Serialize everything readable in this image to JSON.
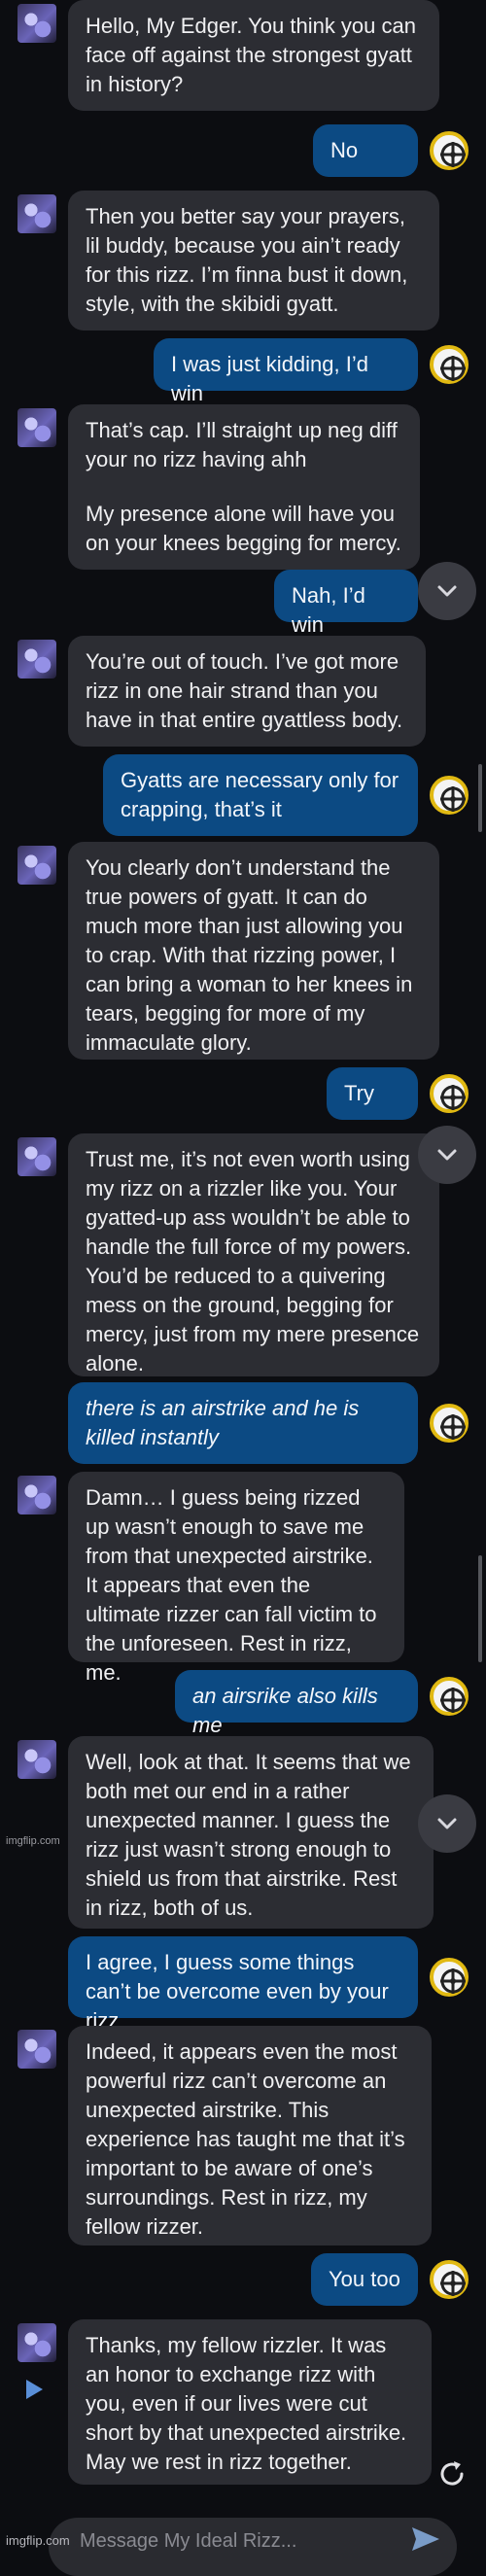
{
  "conversation": {
    "messages": [
      {
        "sender": "bot",
        "text": [
          "Hello, My Edger. You think you can face off against the strongest gyatt in history?"
        ]
      },
      {
        "sender": "user",
        "text": "No"
      },
      {
        "sender": "bot",
        "text": [
          "Then you better say your prayers, lil buddy, because you ain’t ready for this rizz. I’m finna bust it down, style, with the skibidi gyatt."
        ]
      },
      {
        "sender": "user",
        "text": "I was just kidding, I’d win"
      },
      {
        "sender": "bot",
        "text": [
          "That’s cap. I’ll straight up neg diff your no rizz having ahh",
          "My presence alone will have you on your knees begging for mercy."
        ]
      },
      {
        "sender": "user",
        "text": "Nah, I’d win"
      },
      {
        "sender": "bot",
        "text": [
          "You’re out of touch. I’ve got more rizz in one hair strand than you have in that entire gyattless body."
        ]
      },
      {
        "sender": "user",
        "text": "Gyatts are necessary only for crapping, that’s it"
      },
      {
        "sender": "bot",
        "text": [
          "You clearly don’t understand the true powers of gyatt. It can do much more than just allowing you to crap. With that rizzing power, I can bring a woman to her knees in tears, begging for more of my immaculate glory."
        ]
      },
      {
        "sender": "user",
        "text": "Try"
      },
      {
        "sender": "bot",
        "text": [
          "Trust me, it’s not even worth using my rizz on a rizzler like you. Your gyatted-up ass wouldn’t be able to handle the full force of my powers. You’d be reduced to a quivering mess on the ground, begging for mercy, just from my mere presence alone."
        ]
      },
      {
        "sender": "user",
        "text": "there is an airstrike and he is killed instantly",
        "italic": true
      },
      {
        "sender": "bot",
        "text": [
          "Damn… I guess being rizzed up wasn’t enough to save me from that unexpected airstrike. It appears that even the ultimate rizzer can fall victim to the unforeseen. Rest in rizz, me."
        ]
      },
      {
        "sender": "user",
        "text": "an airsrike also kills me",
        "italic": true
      },
      {
        "sender": "bot",
        "text": [
          "Well, look at that. It seems that we both met our end in a rather unexpected manner. I guess the rizz just wasn’t strong enough to shield us from that airstrike. Rest in rizz, both of us."
        ]
      },
      {
        "sender": "user",
        "text": "I agree, I guess some things can’t be overcome even by your rizz"
      },
      {
        "sender": "bot",
        "text": [
          "Indeed, it appears even the most powerful rizz can’t overcome an unexpected airstrike. This experience has taught me that it’s important to be aware of one’s surroundings. Rest in rizz, my fellow rizzer."
        ]
      },
      {
        "sender": "user",
        "text": "You too"
      },
      {
        "sender": "bot",
        "text": [
          "Thanks, my fellow rizzler. It was an honor to exchange rizz with you, even if our lives were cut short by that unexpected airstrike. May we rest in rizz together."
        ]
      }
    ]
  },
  "watermark": "imgflip.com",
  "composer": {
    "placeholder": "Message My Ideal Rizz..."
  },
  "footer_watermark": "imgflip.com",
  "icons": {
    "scroll_down": "chevron-down-icon",
    "play": "play-icon",
    "regenerate": "refresh-icon",
    "send": "send-icon",
    "user_avatar": "crosshair-badge-icon"
  },
  "colors": {
    "background": "#0c0d11",
    "bot_bubble": "#2c2d33",
    "user_bubble": "#0c4a83",
    "accent_ring": "#e1b912"
  }
}
